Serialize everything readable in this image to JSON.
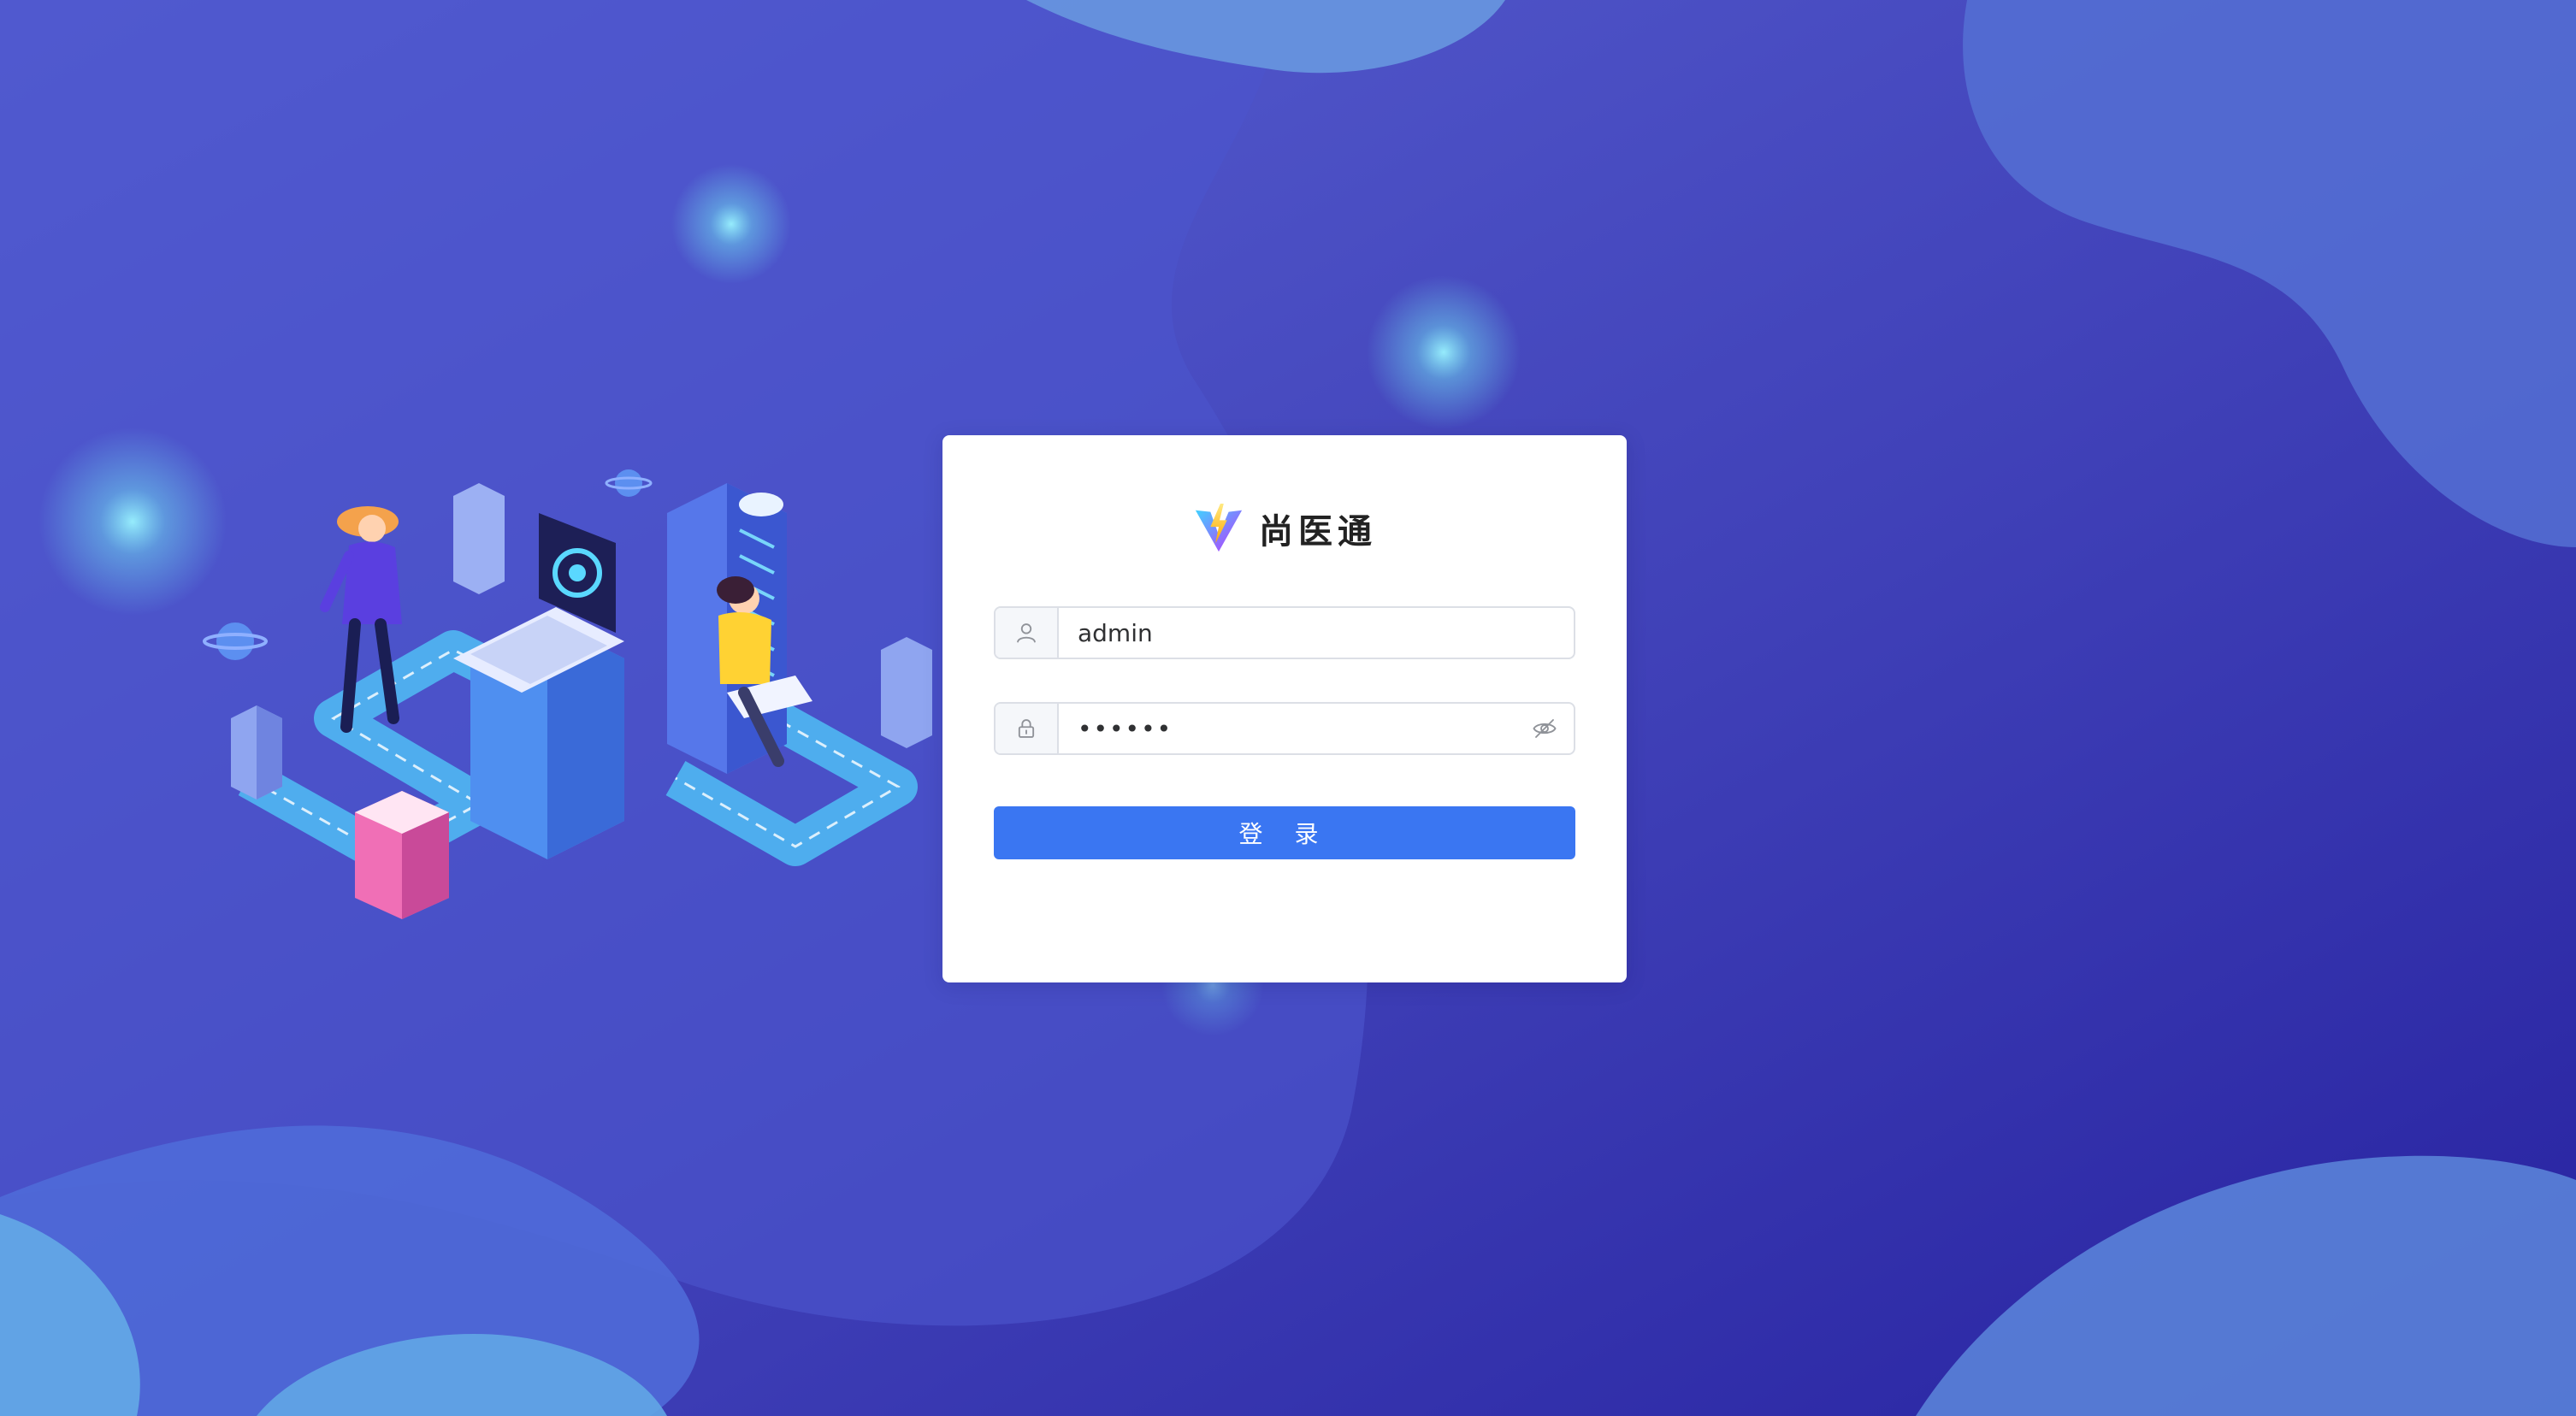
{
  "background": {
    "gradient_start": "#5a63d4",
    "gradient_end": "#2722a0",
    "wave_color": "#5b8ee0",
    "glow_color": "#7fe8ff"
  },
  "login_card": {
    "brand_name": "尚医通",
    "username": {
      "value": "admin",
      "icon": "user-icon"
    },
    "password": {
      "masked_value": "••••••",
      "lock_icon": "lock-icon",
      "toggle_icon": "eye-slash-icon"
    },
    "login_button_label": "登 录",
    "accent_color": "#3a76f2"
  }
}
